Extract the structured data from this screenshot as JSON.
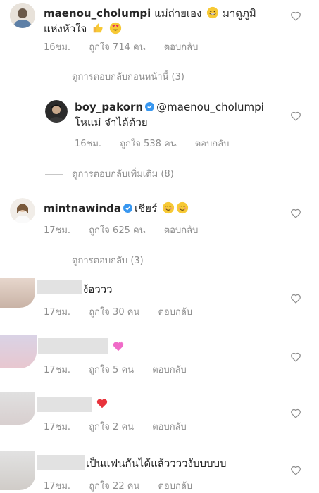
{
  "comments": [
    {
      "username": "maenou_cholumpi",
      "text_line1": "แม่ถ่ายเอง",
      "text_mid": "มาดูภูมิ",
      "text_line2": "แห่งหัวใจ",
      "time": "16ชม.",
      "likes": "ถูกใจ 714 คน",
      "reply": "ตอบกลับ"
    },
    {
      "username": "boy_pakorn",
      "mention": "@maenou_cholumpi",
      "text_line2": "โหแม่ จำได้ด้วย",
      "time": "16ชม.",
      "likes": "ถูกใจ 538 คน",
      "reply": "ตอบกลับ"
    },
    {
      "username": "mintnawinda",
      "text": "เชียร์",
      "time": "17ชม.",
      "likes": "ถูกใจ 625 คน",
      "reply": "ตอบกลับ"
    },
    {
      "text": "ง้อววว",
      "time": "17ชม.",
      "likes": "ถูกใจ 30 คน",
      "reply": "ตอบกลับ"
    },
    {
      "text": "",
      "time": "17ชม.",
      "likes": "ถูกใจ 5 คน",
      "reply": "ตอบกลับ"
    },
    {
      "text": "",
      "time": "17ชม.",
      "likes": "ถูกใจ 2 คน",
      "reply": "ตอบกลับ"
    },
    {
      "text": "เป็นแฟนกันได้แล้ววววงับบบบบ",
      "time": "17ชม.",
      "likes": "ถูกใจ 22 คน",
      "reply": "ตอบกลับ"
    }
  ],
  "reply_links": {
    "previous": "ดูการตอบกลับก่อนหน้านี้ (3)",
    "more": "ดูการตอบกลับเพิ่มเติม (8)",
    "view": "ดูการตอบกลับ (3)"
  },
  "icons": [
    "heart-outline-icon",
    "verified-badge-icon",
    "grinning-face-emoji",
    "thumbs-up-emoji",
    "heart-eyes-emoji",
    "smiling-face-emoji",
    "pink-heart-emoji",
    "red-heart-emoji"
  ],
  "colors": {
    "text": "#262626",
    "muted": "#8e8e8e",
    "verified": "#3897f0"
  }
}
